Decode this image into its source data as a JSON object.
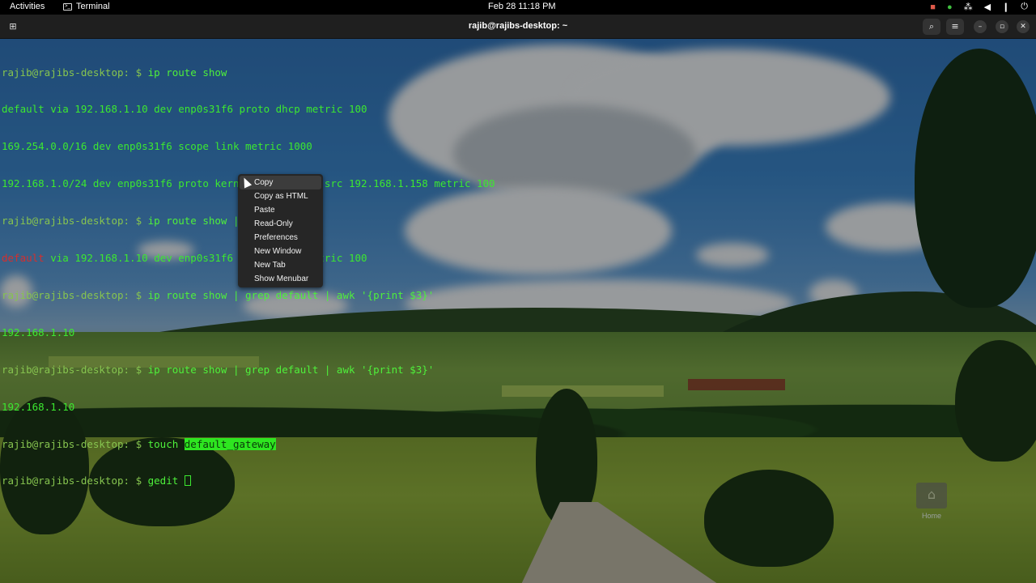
{
  "topbar": {
    "activities": "Activities",
    "app_name": "Terminal",
    "clock": "Feb 28  11:18 PM",
    "tray_icons": [
      "camera-icon",
      "shield-check-icon",
      "network-icon",
      "volume-icon",
      "microphone-icon",
      "power-icon"
    ]
  },
  "window": {
    "title": "rajib@rajibs-desktop: ~"
  },
  "terminal": {
    "prompt": "rajib@rajibs-desktop: $ ",
    "lines": {
      "l1_cmd": "ip route show",
      "l2": "default via 192.168.1.10 dev enp0s31f6 proto dhcp metric 100",
      "l3": "169.254.0.0/16 dev enp0s31f6 scope link metric 1000",
      "l4": "192.168.1.0/24 dev enp0s31f6 proto kernel scope link src 192.168.1.158 metric 100",
      "l5_cmd": "ip route show | grep default",
      "l6_match": "default",
      "l6_rest": " via 192.168.1.10 dev enp0s31f6 proto dhcp metric 100",
      "l7_cmd": "ip route show | grep default | awk '{print $3}'",
      "l8": "192.168.1.10",
      "l9_cmd": "ip route show | grep default | awk '{print $3}'",
      "l10": "192.168.1.10",
      "l11_cmd": "touch ",
      "l11_selected": "default_gateway",
      "l12_cmd": "gedit "
    }
  },
  "context_menu": {
    "items": [
      "Copy",
      "Copy as HTML",
      "Paste",
      "Read-Only",
      "Preferences",
      "New Window",
      "New Tab",
      "Show Menubar"
    ]
  },
  "desktop": {
    "home_label": "Home"
  }
}
